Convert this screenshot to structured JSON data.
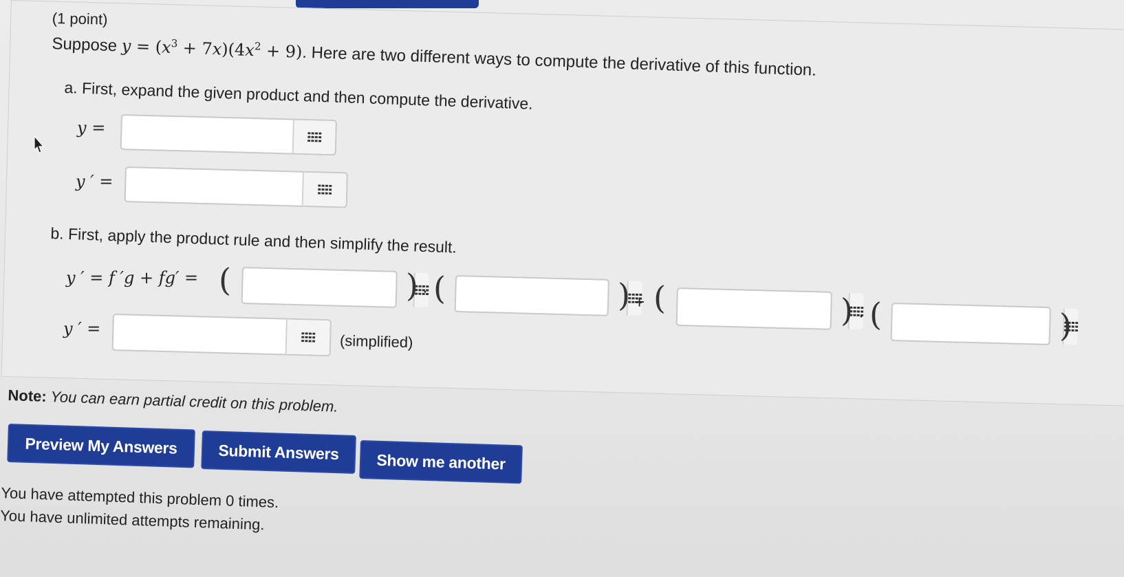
{
  "problem": {
    "points": "(1 point)",
    "intro_prefix": "Suppose ",
    "intro_suffix": ". Here are two different ways to compute the derivative of this function.",
    "part_a": "a. First, expand the given product and then compute the derivative.",
    "part_b": "b. First, apply the product rule and then simplify the result.",
    "simplified_label": "(simplified)"
  },
  "note": {
    "label": "Note:",
    "text": " You can earn partial credit on this problem."
  },
  "answers": {
    "a_y": "",
    "a_yprime": "",
    "b_fprime": "",
    "b_g": "",
    "b_f": "",
    "b_gprime": "",
    "b_simplified": ""
  },
  "buttons": {
    "preview": "Preview My Answers",
    "submit": "Submit Answers",
    "another": "Show me another"
  },
  "status": {
    "attempted": "You have attempted this problem 0 times.",
    "remaining": "You have unlimited attempts remaining."
  },
  "icons": {
    "keypad": "keypad-grid-icon",
    "cursor": "mouse-pointer-icon"
  },
  "colors": {
    "button_blue": "#1f3c97",
    "background": "#ebebeb"
  }
}
